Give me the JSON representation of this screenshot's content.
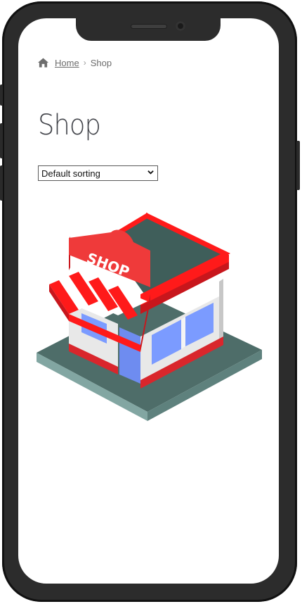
{
  "breadcrumb": {
    "home_label": "Home",
    "separator": "›",
    "current_label": "Shop",
    "icon": "home-icon"
  },
  "page": {
    "title": "Shop"
  },
  "sorting": {
    "selected": "Default sorting",
    "icon": "chevron-down-icon"
  },
  "illustration": {
    "sign_text": "SHOP",
    "icon": "shop-building-illustration",
    "colors": {
      "red": "#ff1a1a",
      "dark_red": "#c8161c",
      "roof": "#3f5e5a",
      "base": "#5a7c78",
      "wall": "#e8e8e8",
      "window": "#7b9bff"
    }
  }
}
